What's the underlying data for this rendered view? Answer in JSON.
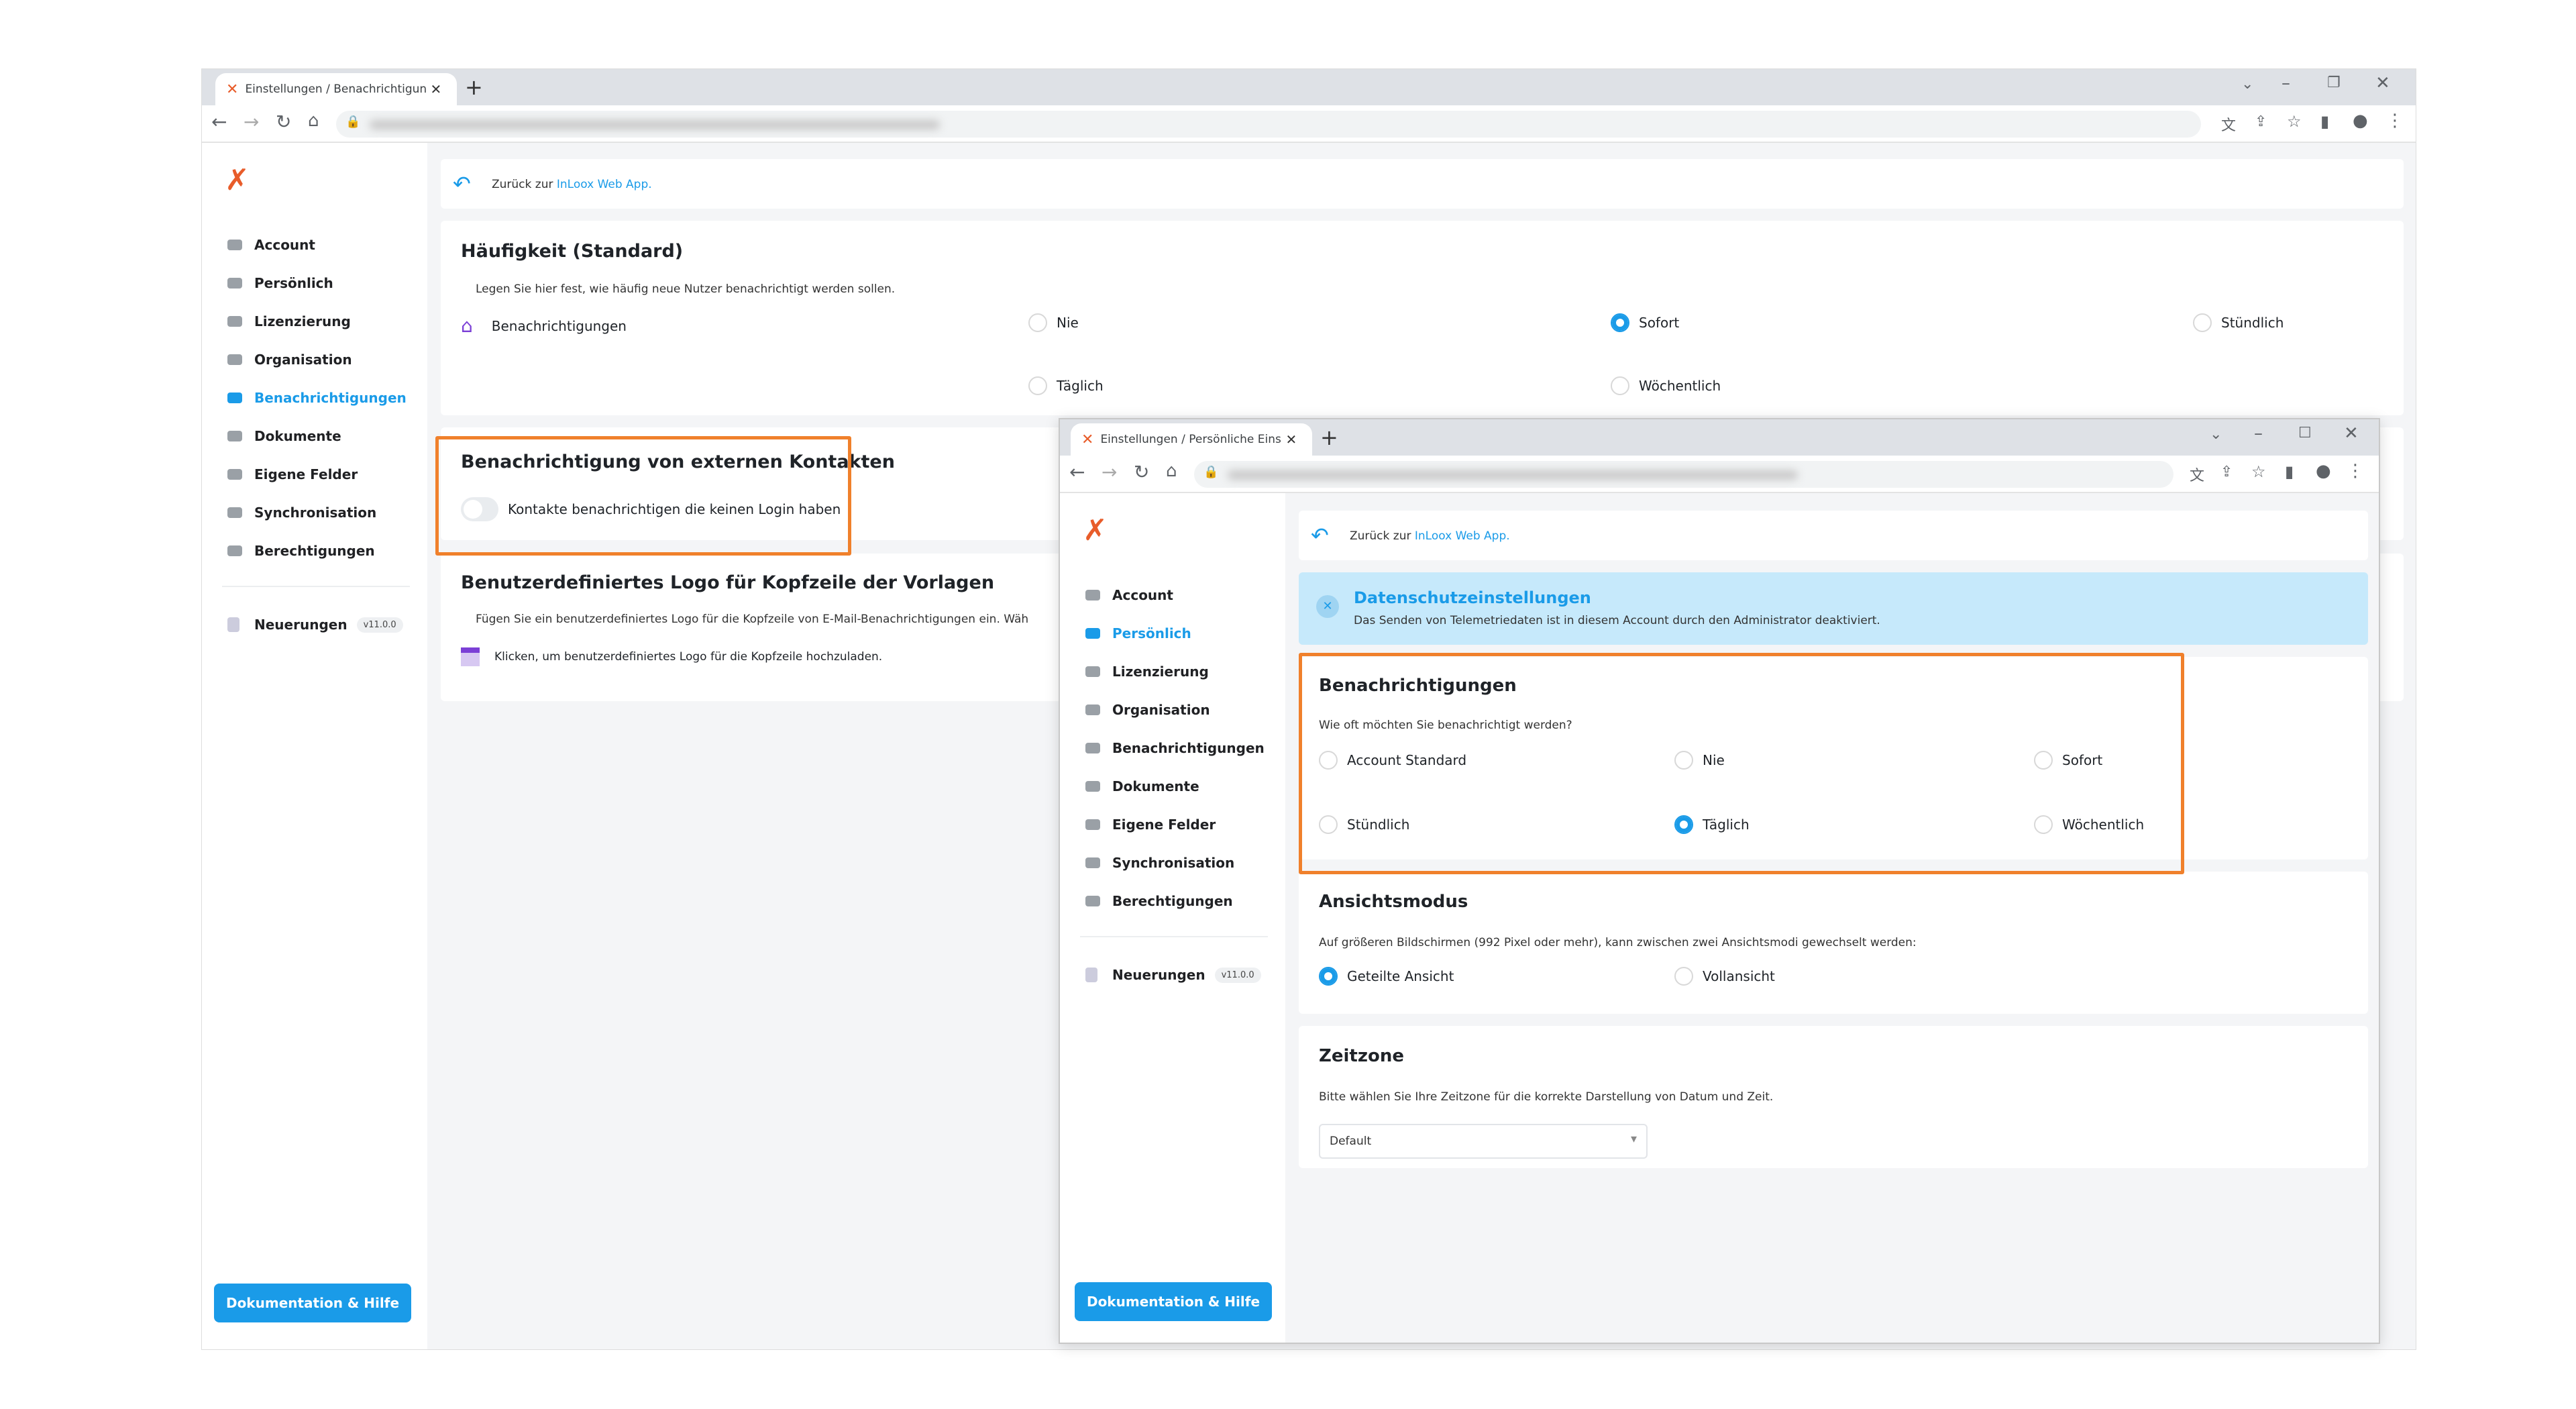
{
  "main_window": {
    "tab_title": "Einstellungen / Benachrichtigungen",
    "back_text": "Zurück zur ",
    "back_link": "InLoox Web App.",
    "sections": {
      "frequency": {
        "title": "Häufigkeit (Standard)",
        "description": "Legen Sie hier fest, wie häufig neue Nutzer benachrichtigt werden sollen.",
        "row_label": "Benachrichtigungen",
        "options": [
          "Nie",
          "Sofort",
          "Stündlich",
          "Täglich",
          "Wöchentlich"
        ],
        "selected": "Sofort"
      },
      "external": {
        "title": "Benachrichtigung von externen Kontakten",
        "toggle_label": "Kontakte benachrichtigen die keinen Login haben",
        "toggle_on": false
      },
      "logo": {
        "title": "Benutzerdefiniertes Logo für Kopfzeile der Vorlagen",
        "description": "Fügen Sie ein benutzerdefiniertes Logo für die Kopfzeile von E-Mail-Benachrichtigungen ein. Wäh",
        "upload_label": "Klicken, um benutzerdefiniertes Logo für die Kopfzeile hochzuladen."
      }
    }
  },
  "sidebar": {
    "items": [
      {
        "label": "Account",
        "icon": "account-icon"
      },
      {
        "label": "Persönlich",
        "icon": "person-icon"
      },
      {
        "label": "Lizenzierung",
        "icon": "license-icon"
      },
      {
        "label": "Organisation",
        "icon": "organisation-icon"
      },
      {
        "label": "Benachrichtigungen",
        "icon": "notification-icon"
      },
      {
        "label": "Dokumente",
        "icon": "folder-icon"
      },
      {
        "label": "Eigene Felder",
        "icon": "fields-icon"
      },
      {
        "label": "Synchronisation",
        "icon": "sync-icon"
      },
      {
        "label": "Berechtigungen",
        "icon": "permission-icon"
      }
    ],
    "news_label": "Neuerungen",
    "version": "v11.0.0",
    "help_button": "Dokumentation & Hilfe"
  },
  "overlay_window": {
    "tab_title": "Einstellungen / Persönliche Einstellungen",
    "back_text": "Zurück zur ",
    "back_link": "InLoox Web App.",
    "privacy": {
      "title": "Datenschutzeinstellungen",
      "text": "Das Senden von Telemetriedaten ist in diesem Account durch den Administrator deaktiviert."
    },
    "notifications": {
      "title": "Benachrichtigungen",
      "description": "Wie oft möchten Sie benachrichtigt werden?",
      "options": [
        "Account Standard",
        "Nie",
        "Sofort",
        "Stündlich",
        "Täglich",
        "Wöchentlich"
      ],
      "selected": "Täglich"
    },
    "view_mode": {
      "title": "Ansichtsmodus",
      "description": "Auf größeren Bildschirmen (992 Pixel oder mehr), kann zwischen zwei Ansichtsmodi gewechselt werden:",
      "options": [
        "Geteilte Ansicht",
        "Vollansicht"
      ],
      "selected": "Geteilte Ansicht"
    },
    "timezone": {
      "title": "Zeitzone",
      "description": "Bitte wählen Sie Ihre Zeitzone für die korrekte Darstellung von Datum und Zeit.",
      "selected": "Default"
    }
  },
  "colors": {
    "accent": "#1a9be8",
    "highlight": "#f0802b",
    "background": "#f4f5f7"
  }
}
